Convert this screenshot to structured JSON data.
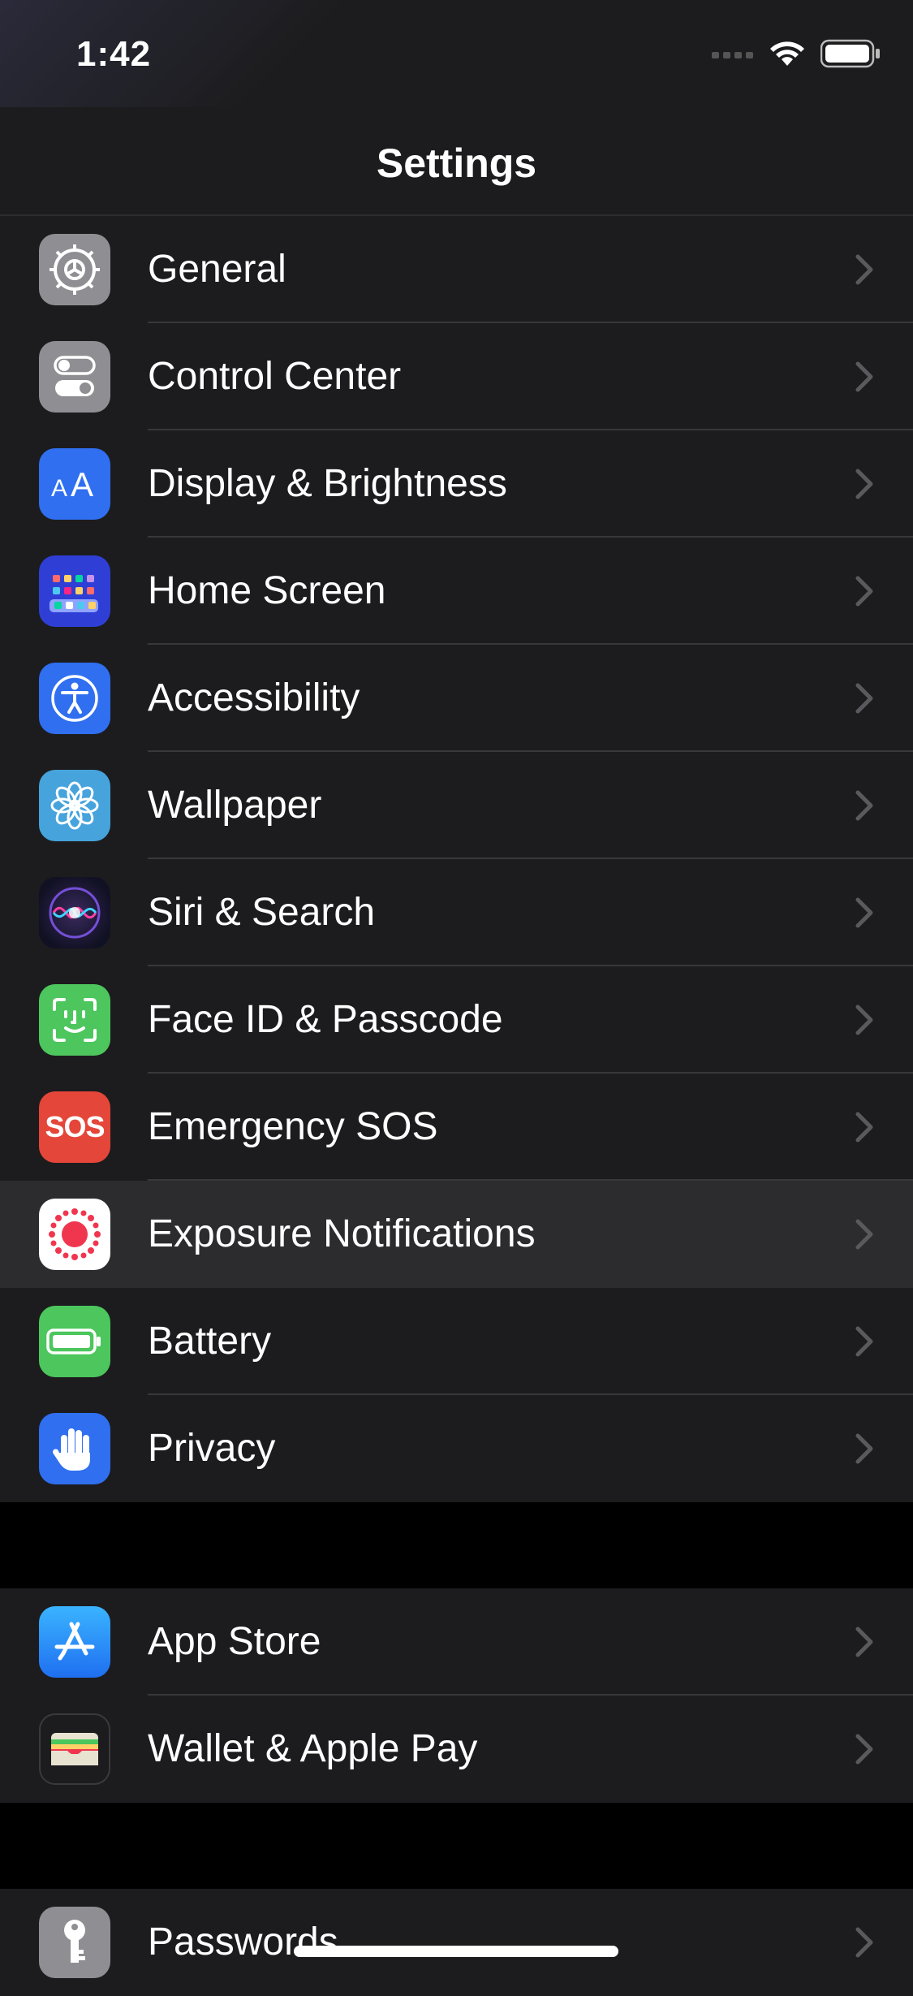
{
  "status_bar": {
    "time": "1:42"
  },
  "nav": {
    "title": "Settings"
  },
  "groups": [
    {
      "items": [
        {
          "label": "General",
          "icon": "gear-icon",
          "color": "#8e8e93"
        },
        {
          "label": "Control Center",
          "icon": "toggles-icon",
          "color": "#8e8e93"
        },
        {
          "label": "Display & Brightness",
          "icon": "text-size-icon",
          "color": "#2f6ff0",
          "icon_text": "AA"
        },
        {
          "label": "Home Screen",
          "icon": "app-grid-icon",
          "color": "#2f3fd6"
        },
        {
          "label": "Accessibility",
          "icon": "accessibility-icon",
          "color": "#2f6ff0"
        },
        {
          "label": "Wallpaper",
          "icon": "flower-icon",
          "color": "#46a3dc"
        },
        {
          "label": "Siri & Search",
          "icon": "siri-icon",
          "color": "#1a1a2e"
        },
        {
          "label": "Face ID & Passcode",
          "icon": "face-id-icon",
          "color": "#4cc65d"
        },
        {
          "label": "Emergency SOS",
          "icon": "sos-icon",
          "color": "#e5463a",
          "icon_text": "SOS"
        },
        {
          "label": "Exposure Notifications",
          "icon": "exposure-icon",
          "color": "#ffffff",
          "highlighted": true
        },
        {
          "label": "Battery",
          "icon": "battery-icon",
          "color": "#4cc65d"
        },
        {
          "label": "Privacy",
          "icon": "hand-icon",
          "color": "#2f6ff0"
        }
      ]
    },
    {
      "items": [
        {
          "label": "App Store",
          "icon": "app-store-icon",
          "color": "#2f8cf6"
        },
        {
          "label": "Wallet & Apple Pay",
          "icon": "wallet-icon",
          "color": "#1c1c1e"
        }
      ]
    },
    {
      "items": [
        {
          "label": "Passwords",
          "icon": "key-icon",
          "color": "#8e8e93"
        }
      ]
    }
  ]
}
